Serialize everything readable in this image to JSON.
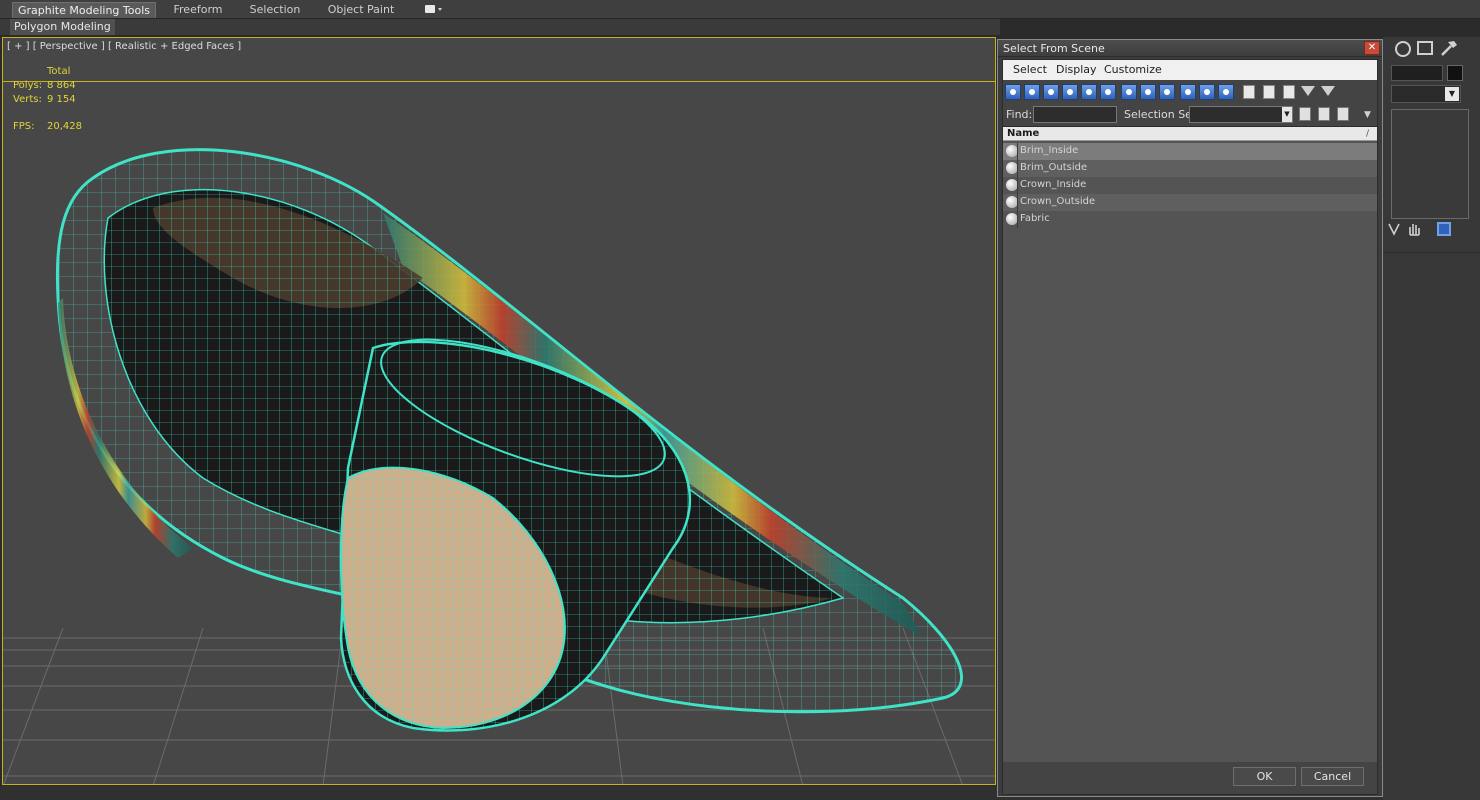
{
  "ribbon": {
    "tabs": [
      {
        "label": "Graphite Modeling Tools",
        "active": true
      },
      {
        "label": "Freeform",
        "active": false
      },
      {
        "label": "Selection",
        "active": false
      },
      {
        "label": "Object Paint",
        "active": false
      }
    ],
    "subpanel_label": "Polygon Modeling",
    "extra_dropdown_icon": "panel-dropdown-icon"
  },
  "viewport": {
    "label": "[ + ] [ Perspective ] [ Realistic + Edged Faces ]",
    "stats": {
      "header": "Total",
      "polys_label": "Polys:",
      "polys_value": "8 864",
      "verts_label": "Verts:",
      "verts_value": "9 154",
      "fps_label": "FPS:",
      "fps_value": "20,428"
    },
    "colors": {
      "wire": "#3fe3c7",
      "active_border": "#c8b21c",
      "stats_text": "#e0d436",
      "background": "#474747",
      "crown_tan": "#cfae8c",
      "crown_dark": "#1c1c1c"
    }
  },
  "dialog": {
    "title": "Select From Scene",
    "close_icon": "close-icon",
    "menu": [
      "Select",
      "Display",
      "Customize"
    ],
    "toolbar_icons": [
      "display-geometry-icon",
      "display-shapes-icon",
      "display-lights-icon",
      "display-cameras-icon",
      "display-helpers-icon",
      "display-spacewarps-icon",
      "display-groups-icon",
      "display-xrefs-icon",
      "display-bones-icon",
      "display-containers-icon",
      "display-frozen-icon",
      "display-hidden-icon",
      "display-all-icon",
      "select-all-icon",
      "select-none-icon",
      "select-invert-icon",
      "filter-icon",
      "filter-options-icon"
    ],
    "find_label": "Find:",
    "find_value": "",
    "selection_set_label": "Selection Set:",
    "selection_set_value": "",
    "list_header": "Name",
    "items": [
      {
        "name": "Brim_Inside",
        "selected": true
      },
      {
        "name": "Brim_Outside",
        "selected": false
      },
      {
        "name": "Crown_Inside",
        "selected": false
      },
      {
        "name": "Crown_Outside",
        "selected": false
      },
      {
        "name": "Fabric",
        "selected": false
      }
    ],
    "ok_label": "OK",
    "cancel_label": "Cancel"
  },
  "command_panel": {
    "icons": [
      "display-icon",
      "utilities-icon",
      "hammer-icon",
      "pin-stack-icon",
      "hand-icon",
      "modifier-config-icon"
    ]
  }
}
